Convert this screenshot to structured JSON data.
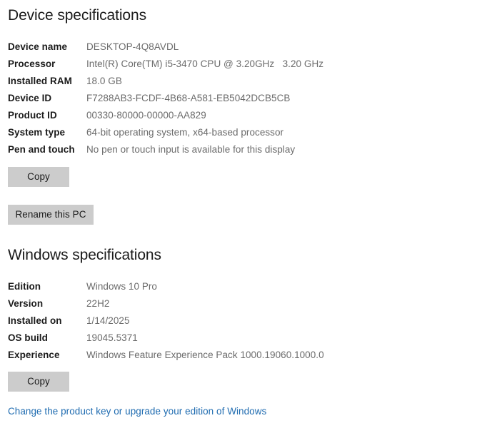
{
  "device_section": {
    "heading": "Device specifications",
    "rows": [
      {
        "label": "Device name",
        "value": "DESKTOP-4Q8AVDL"
      },
      {
        "label": "Processor",
        "value": "Intel(R) Core(TM) i5-3470 CPU @ 3.20GHz   3.20 GHz"
      },
      {
        "label": "Installed RAM",
        "value": "18.0 GB"
      },
      {
        "label": "Device ID",
        "value": "F7288AB3-FCDF-4B68-A581-EB5042DCB5CB"
      },
      {
        "label": "Product ID",
        "value": "00330-80000-00000-AA829"
      },
      {
        "label": "System type",
        "value": "64-bit operating system, x64-based processor"
      },
      {
        "label": "Pen and touch",
        "value": "No pen or touch input is available for this display"
      }
    ],
    "copy_label": "Copy",
    "rename_label": "Rename this PC"
  },
  "windows_section": {
    "heading": "Windows specifications",
    "rows": [
      {
        "label": "Edition",
        "value": "Windows 10 Pro"
      },
      {
        "label": "Version",
        "value": "22H2"
      },
      {
        "label": "Installed on",
        "value": "1/14/2025"
      },
      {
        "label": "OS build",
        "value": "19045.5371"
      },
      {
        "label": "Experience",
        "value": "Windows Feature Experience Pack 1000.19060.1000.0"
      }
    ],
    "copy_label": "Copy",
    "product_key_link": "Change the product key or upgrade your edition of Windows"
  },
  "colors": {
    "background": "#ffffff",
    "label_text": "#1b1b1b",
    "value_text": "#6b6b6b",
    "button_face": "#cccccc",
    "link_accent": "#1e6bb0"
  }
}
